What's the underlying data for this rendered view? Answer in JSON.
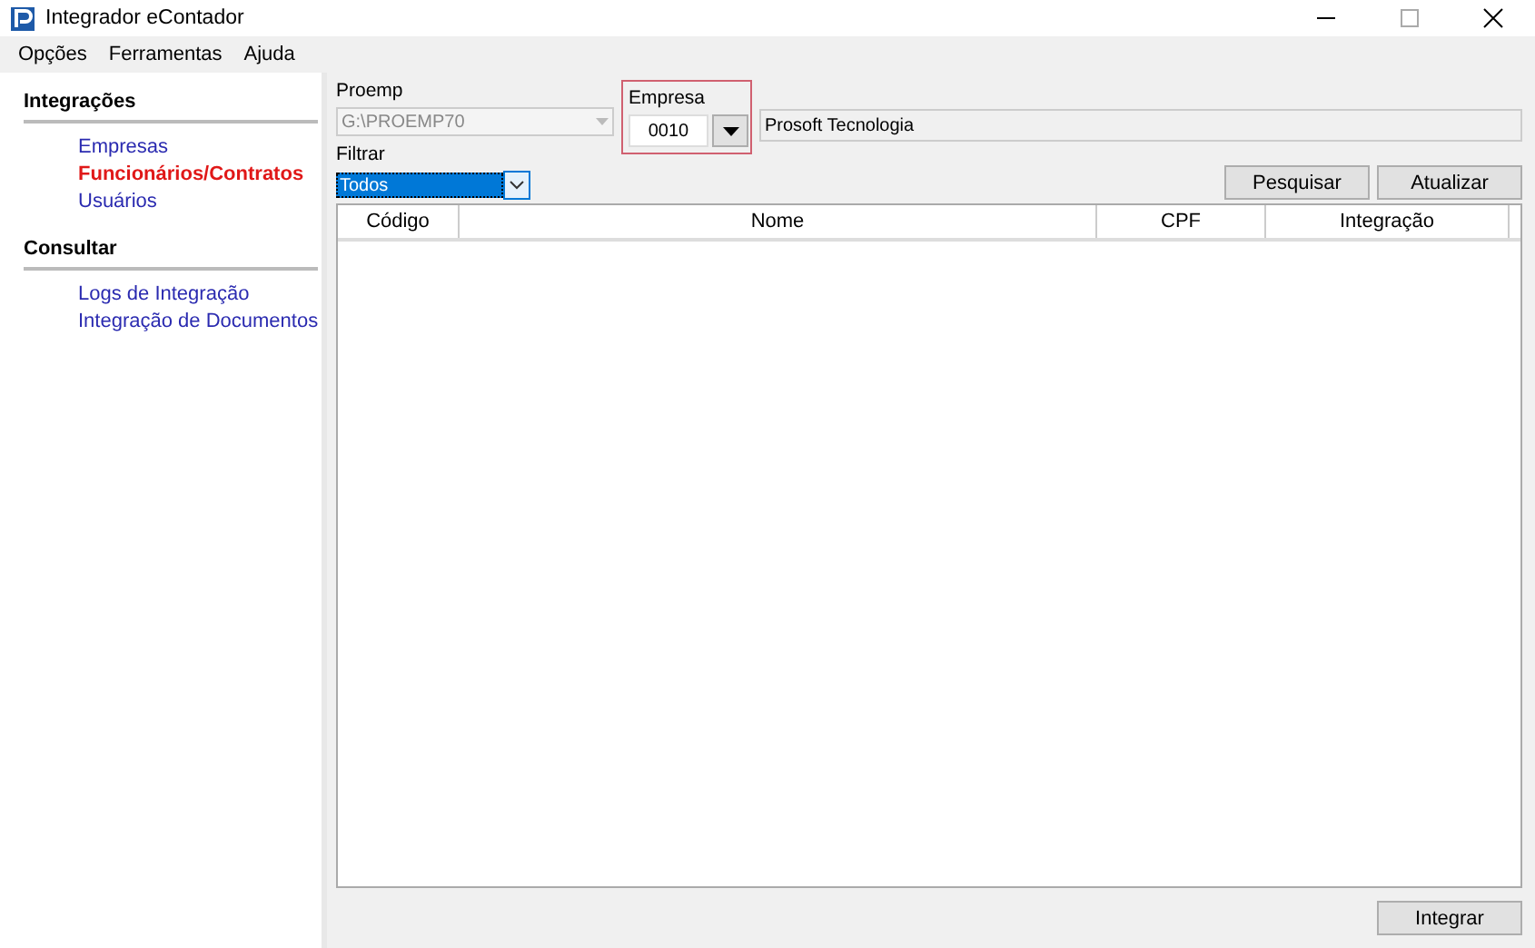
{
  "window": {
    "title": "Integrador eContador"
  },
  "menu": [
    "Opções",
    "Ferramentas",
    "Ajuda"
  ],
  "sidebar": {
    "sections": [
      {
        "title": "Integrações",
        "items": [
          {
            "label": "Empresas",
            "selected": false
          },
          {
            "label": "Funcionários/Contratos",
            "selected": true
          },
          {
            "label": "Usuários",
            "selected": false
          }
        ]
      },
      {
        "title": "Consultar",
        "items": [
          {
            "label": "Logs de Integração",
            "selected": false
          },
          {
            "label": "Integração de Documentos",
            "selected": false
          }
        ]
      }
    ]
  },
  "proemp": {
    "label": "Proemp",
    "value": "G:\\PROEMP70",
    "disabled": true
  },
  "empresa": {
    "label": "Empresa",
    "value": "0010",
    "name": "Prosoft Tecnologia"
  },
  "filtrar": {
    "label": "Filtrar",
    "value": "Todos"
  },
  "buttons": [
    "Pesquisar",
    "Atualizar"
  ],
  "table": {
    "columns": [
      "Código",
      "Nome",
      "CPF",
      "Integração"
    ]
  },
  "footer_button": "Integrar"
}
